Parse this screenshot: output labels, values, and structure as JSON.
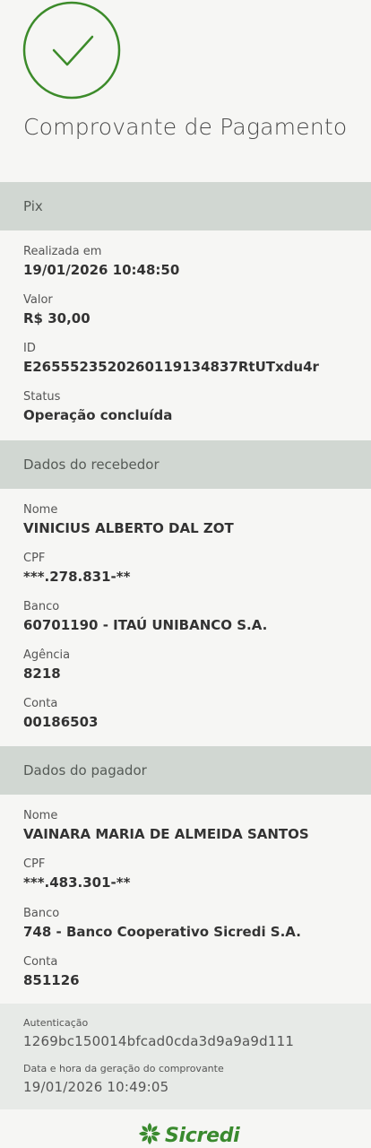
{
  "header": {
    "title": "Comprovante de Pagamento"
  },
  "sections": {
    "pix": {
      "title": "Pix",
      "realizada_label": "Realizada em",
      "realizada_value": "19/01/2026 10:48:50",
      "valor_label": "Valor",
      "valor_value": "R$ 30,00",
      "id_label": "ID",
      "id_value": "E26555235202601191348 37RtUTxdu4r",
      "status_label": "Status",
      "status_value": "Operação concluída"
    },
    "recebedor": {
      "title": "Dados do recebedor",
      "nome_label": "Nome",
      "nome_value": "VINICIUS ALBERTO DAL ZOT",
      "cpf_label": "CPF",
      "cpf_value": "***.278.831-**",
      "banco_label": "Banco",
      "banco_value": "60701190 - ITAÚ UNIBANCO S.A.",
      "agencia_label": "Agência",
      "agencia_value": "8218",
      "conta_label": "Conta",
      "conta_value": "00186503"
    },
    "pagador": {
      "title": "Dados do pagador",
      "nome_label": "Nome",
      "nome_value": "VAINARA MARIA DE ALMEIDA SANTOS",
      "cpf_label": "CPF",
      "cpf_value": "***.483.301-**",
      "banco_label": "Banco",
      "banco_value": "748 - Banco Cooperativo Sicredi S.A.",
      "conta_label": "Conta",
      "conta_value": "851126"
    }
  },
  "auth": {
    "autenticacao_label": "Autenticação",
    "autenticacao_value": "1269bc150014bfcad0cda3d9a9a9d111",
    "geracao_label": "Data e hora da geração do comprovante",
    "geracao_value": "19/01/2026 10:49:05"
  },
  "footer": {
    "brand": "Sicredi"
  },
  "colors": {
    "brand_green": "#3a8a2e",
    "check_green": "#3c8b2a",
    "section_header_bg": "#d1d7d2",
    "auth_bg": "#e7eae7",
    "page_bg": "#f6f6f4"
  },
  "icons": {
    "success": "check-circle-icon",
    "brand": "sicredi-logo-icon"
  }
}
